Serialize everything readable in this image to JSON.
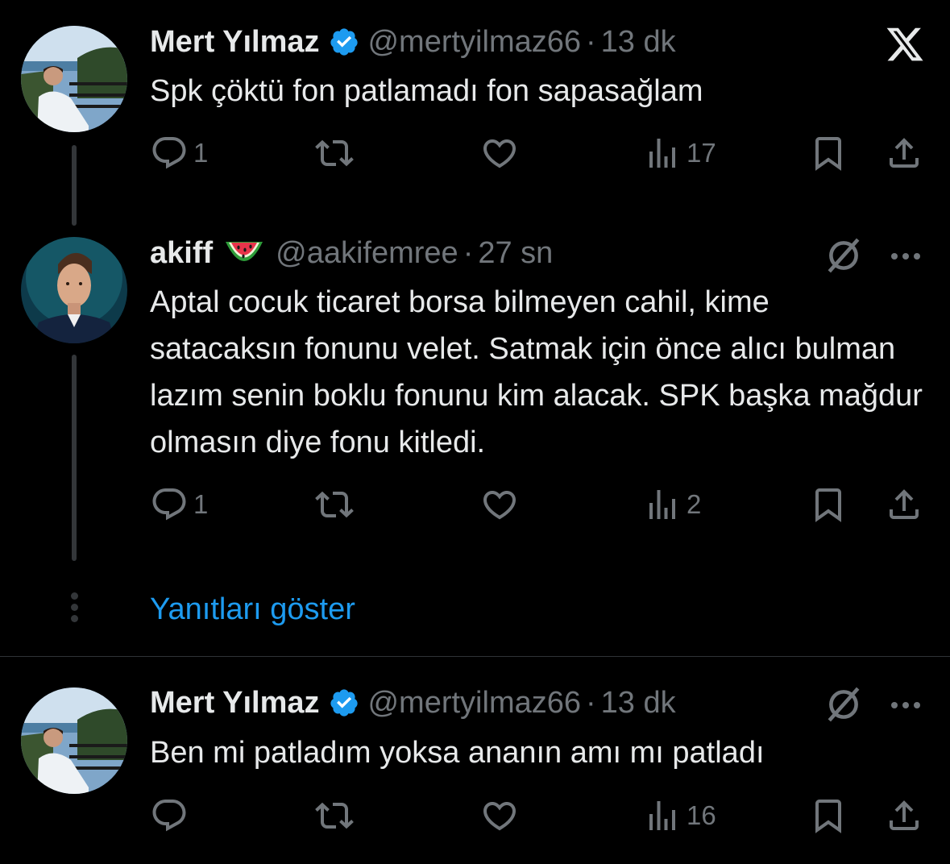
{
  "colors": {
    "accent": "#1d9bf0",
    "muted": "#71767b",
    "text": "#e7e9ea",
    "background": "#000000"
  },
  "tweets": [
    {
      "name": "Mert Yılmaz",
      "handle": "@mertyilmaz66",
      "dot": "·",
      "time": "13 dk",
      "verified": true,
      "text": "Spk çöktü fon patlamadı fon sapasağlam",
      "replies": "1",
      "views": "17",
      "top_right_icon": "x-logo-icon"
    },
    {
      "name": "akiff",
      "emoji": "watermelon-emoji",
      "handle": "@aakifemree",
      "dot": "·",
      "time": "27 sn",
      "text": "Aptal cocuk ticaret borsa bilmeyen cahil, kime satacaksın fonunu velet. Satmak için önce alıcı bulman lazım senin boklu fonunu kim alacak. SPK başka mağdur olmasın diye fonu kitledi.",
      "replies": "1",
      "views": "2"
    },
    {
      "name": "Mert Yılmaz",
      "handle": "@mertyilmaz66",
      "dot": "·",
      "time": "13 dk",
      "verified": true,
      "text": "Ben mi patladım yoksa ananın amı mı patladı",
      "replies": "",
      "views": "16"
    }
  ],
  "show_replies_label": "Yanıtları göster"
}
